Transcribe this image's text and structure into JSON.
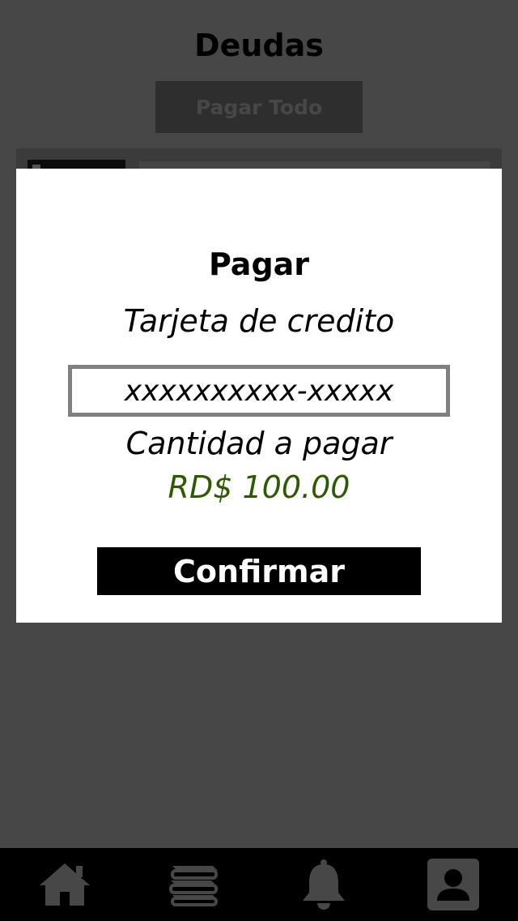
{
  "header": {
    "title": "Deudas",
    "pay_all_label": "Pagar Todo"
  },
  "modal": {
    "title": "Pagar",
    "card_label": "Tarjeta de credito",
    "card_placeholder": "xxxxxxxxxx-xxxxx",
    "amount_label": "Cantidad a pagar",
    "amount_value": "RD$ 100.00",
    "confirm_label": "Confirmar"
  },
  "colors": {
    "amount": "#2d5a00",
    "icon": "#474747"
  },
  "nav": {
    "items": [
      {
        "icon": "home-icon"
      },
      {
        "icon": "books-icon"
      },
      {
        "icon": "bell-icon"
      },
      {
        "icon": "profile-icon"
      }
    ]
  }
}
